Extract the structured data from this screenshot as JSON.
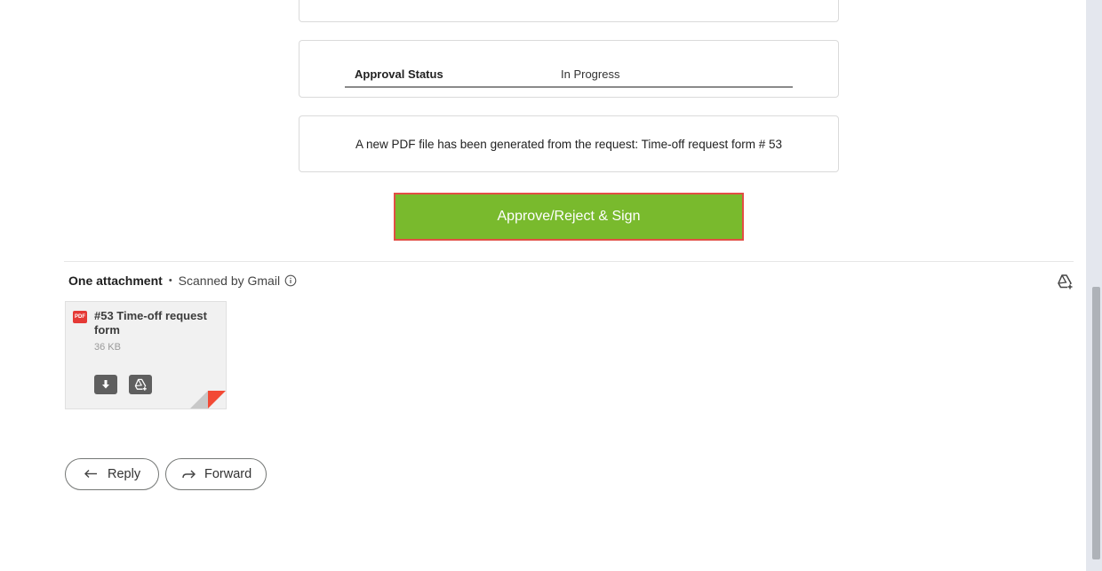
{
  "email": {
    "approval": {
      "label": "Approval Status",
      "value": "In Progress"
    },
    "message": "A new PDF file has been generated from the request: Time-off request form # 53",
    "action_button": "Approve/Reject & Sign"
  },
  "attachments": {
    "count_label": "One attachment",
    "scan_label": "Scanned by Gmail",
    "file": {
      "type_badge": "PDF",
      "name": "#53 Time-off request form",
      "size": "36 KB"
    }
  },
  "actions": {
    "reply": "Reply",
    "forward": "Forward"
  },
  "colors": {
    "action_button_bg": "#79ba2d",
    "action_button_border": "#e24e45",
    "pdf_badge": "#e53935"
  },
  "icons": [
    "info-icon",
    "drive-add-icon",
    "download-icon",
    "reply-icon",
    "forward-icon"
  ]
}
